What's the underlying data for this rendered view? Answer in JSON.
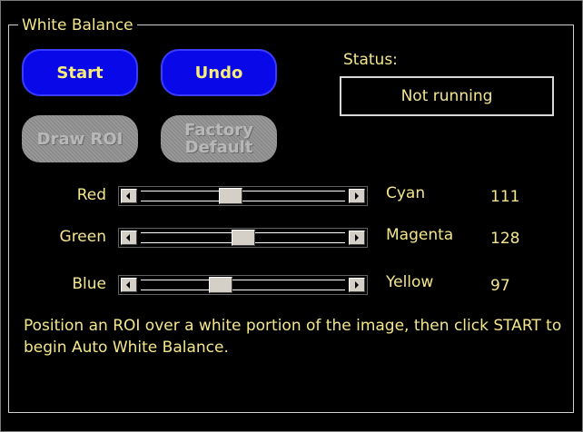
{
  "group": {
    "title": "White Balance"
  },
  "buttons": {
    "start": "Start",
    "undo": "Undo",
    "draw_roi": "Draw ROI",
    "factory_default_line1": "Factory",
    "factory_default_line2": "Default"
  },
  "status": {
    "label": "Status:",
    "value": "Not running"
  },
  "sliders": [
    {
      "left_label": "Red",
      "right_label": "Cyan",
      "value": "111",
      "position": 111,
      "max": 255
    },
    {
      "left_label": "Green",
      "right_label": "Magenta",
      "value": "128",
      "position": 128,
      "max": 255
    },
    {
      "left_label": "Blue",
      "right_label": "Yellow",
      "value": "97",
      "position": 97,
      "max": 255
    }
  ],
  "instructions": "Position an ROI over a white portion of the image, then click START to begin Auto White Balance.",
  "colors": {
    "text": "#f4e68c",
    "button_active": "#0808e8",
    "button_disabled": "#8a8a8a",
    "background": "#000000"
  },
  "icons": {
    "scroll_left": "triangle-left",
    "scroll_right": "triangle-right"
  }
}
